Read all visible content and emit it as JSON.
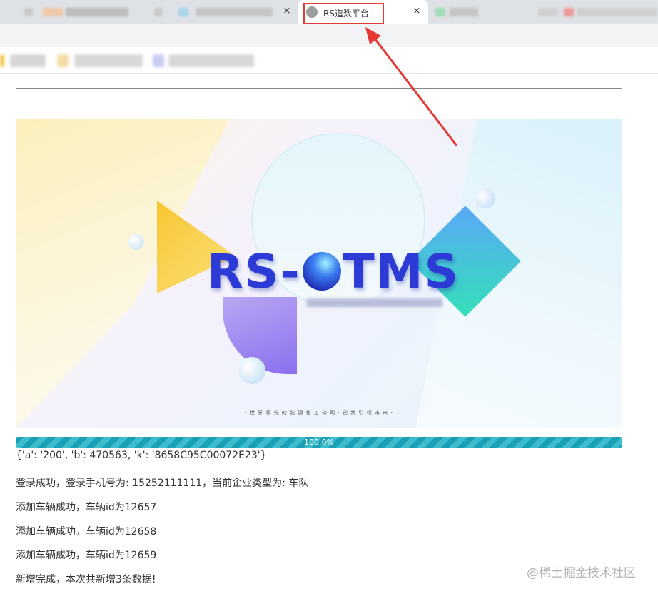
{
  "tabs": {
    "active_title": "RS造数平台",
    "close_icon": "×"
  },
  "banner": {
    "logo_left": "RS-",
    "logo_right": "TMS",
    "slogan": "- 世 界 领 先 的 能 源 化 工 公 司 · 创 新 引 领 未 来 -"
  },
  "progress": {
    "label": "100.0%",
    "value": 100,
    "color": "#1aa0b5"
  },
  "log": {
    "lines": [
      "{'a': '200', 'b': 470563, 'k': '8658C95C00072E23'}",
      "登录成功，登录手机号为: 15252111111，当前企业类型为: 车队",
      "添加车辆成功，车辆id为12657",
      "添加车辆成功，车辆id为12658",
      "添加车辆成功，车辆id为12659",
      "新增完成，本次共新增3条数据!"
    ]
  },
  "watermark": "@稀土掘金技术社区",
  "colors": {
    "annotation_red": "#e53935",
    "logo_blue": "#2d3bd6"
  }
}
